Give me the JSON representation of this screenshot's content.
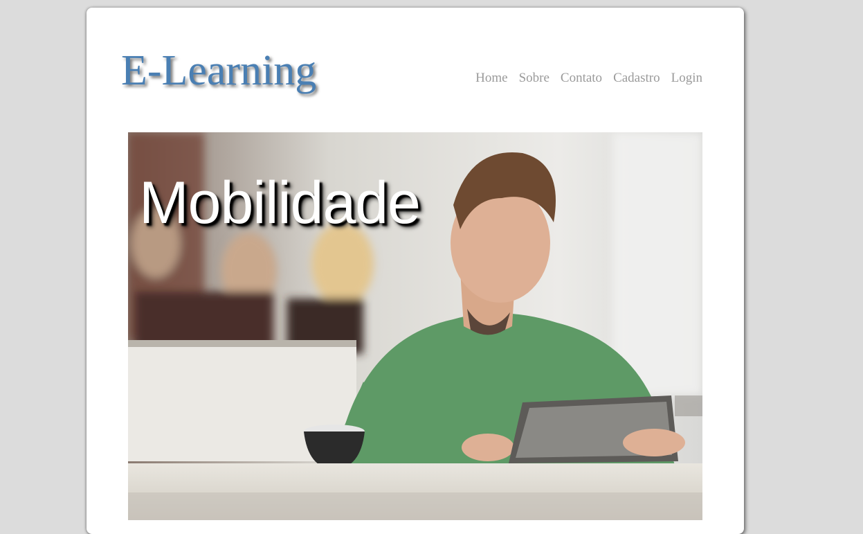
{
  "site": {
    "logo_text": "E-Learning"
  },
  "nav": {
    "items": [
      {
        "label": "Home"
      },
      {
        "label": "Sobre"
      },
      {
        "label": "Contato"
      },
      {
        "label": "Cadastro"
      },
      {
        "label": "Login"
      }
    ]
  },
  "hero": {
    "title": "Mobilidade",
    "image_subject": "man-using-tablet-in-cafe"
  },
  "colors": {
    "page_background": "#dcdcdc",
    "card_background": "#ffffff",
    "logo": "#4a7fb3",
    "nav_link": "#9a9a9a"
  }
}
